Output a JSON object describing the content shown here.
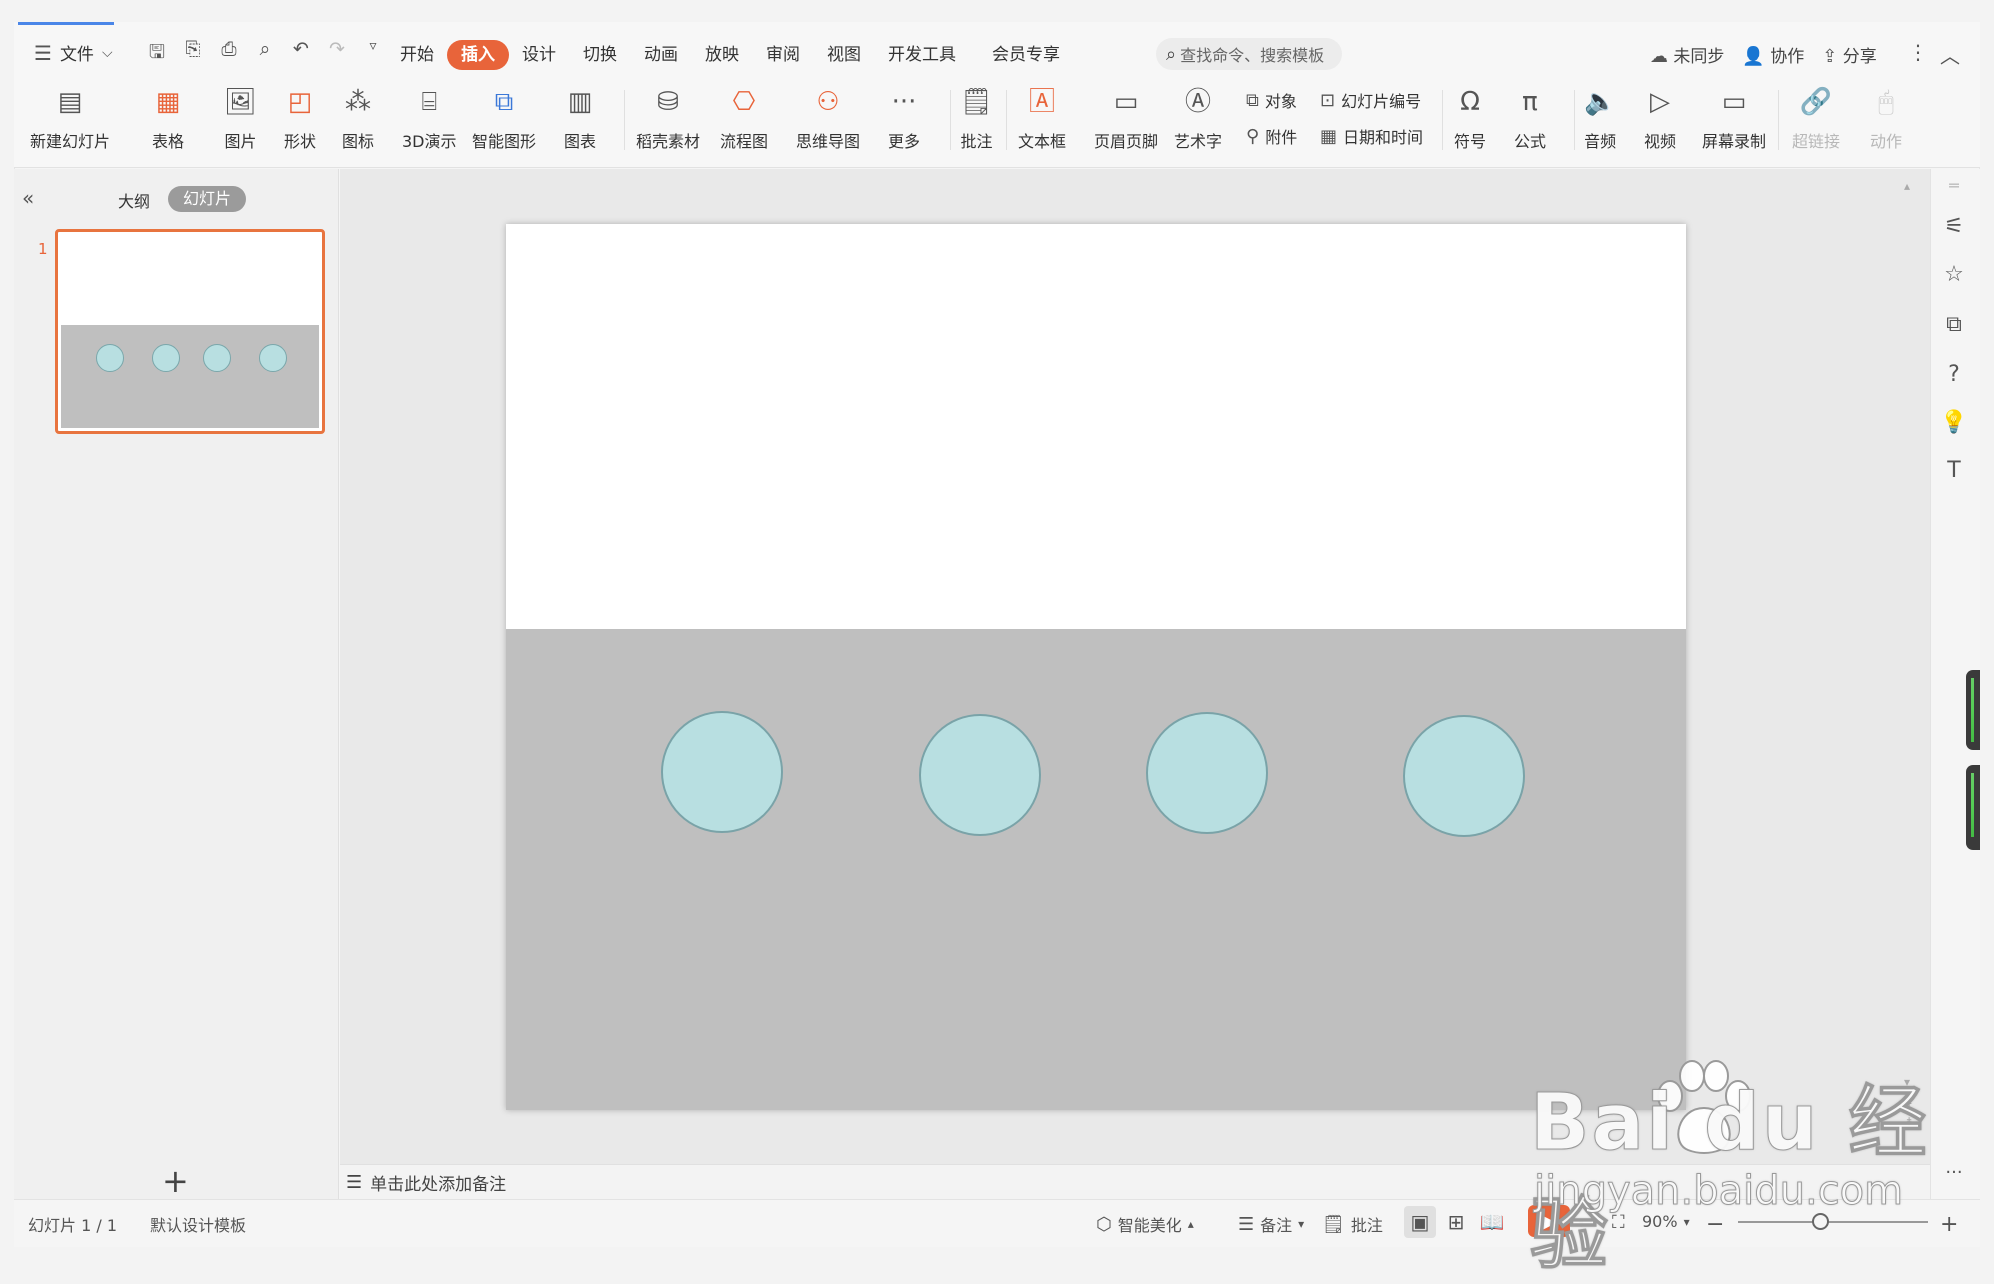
{
  "menubar": {
    "file_label": "文件",
    "tabs": [
      {
        "label": "开始"
      },
      {
        "label": "插入"
      },
      {
        "label": "设计"
      },
      {
        "label": "切换"
      },
      {
        "label": "动画"
      },
      {
        "label": "放映"
      },
      {
        "label": "审阅"
      },
      {
        "label": "视图"
      },
      {
        "label": "开发工具"
      },
      {
        "label": "会员专享"
      }
    ],
    "active_tab": "插入",
    "search_placeholder": "查找命令、搜索模板",
    "right": {
      "sync_label": "未同步",
      "collab_label": "协作",
      "share_label": "分享"
    }
  },
  "ribbon": {
    "new_slide": "新建幻灯片",
    "table": "表格",
    "picture": "图片",
    "shape": "形状",
    "icon": "图标",
    "demo3d": "3D演示",
    "smartart": "智能图形",
    "chart": "图表",
    "docer": "稻壳素材",
    "flow": "流程图",
    "mindmap": "思维导图",
    "more": "更多",
    "comment": "批注",
    "textbox": "文本框",
    "header_footer": "页眉页脚",
    "wordart": "艺术字",
    "object": "对象",
    "slide_number": "幻灯片编号",
    "attachment": "附件",
    "datetime": "日期和时间",
    "symbol": "符号",
    "formula": "公式",
    "audio": "音频",
    "video": "视频",
    "screen_record": "屏幕录制",
    "hyperlink": "超链接",
    "action": "动作"
  },
  "leftpanel": {
    "outline_tab": "大纲",
    "slides_tab": "幻灯片",
    "slide_number": "1"
  },
  "slide": {
    "colors": {
      "top": "#ffffff",
      "bottom": "#bfbfbf",
      "circle_fill": "#b8dfe1",
      "circle_stroke": "#7aa3a8"
    }
  },
  "notes": {
    "placeholder": "单击此处添加备注"
  },
  "statusbar": {
    "slide_count": "幻灯片 1 / 1",
    "template": "默认设计模板",
    "beautify": "智能美化",
    "notes": "备注",
    "comment": "批注",
    "zoom": "90%"
  },
  "watermark": {
    "brand": "Bai du 经验",
    "url": "jingyan.baidu.com"
  }
}
